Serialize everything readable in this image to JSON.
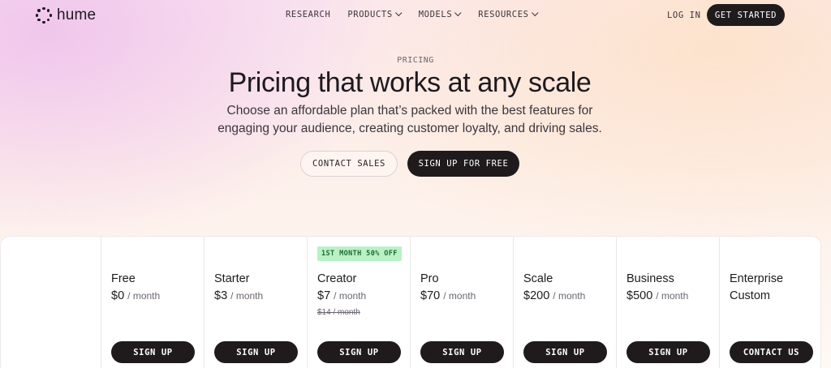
{
  "nav": {
    "logo_text": "hume",
    "links": [
      {
        "label": "RESEARCH",
        "has_dropdown": false
      },
      {
        "label": "PRODUCTS",
        "has_dropdown": true
      },
      {
        "label": "MODELS",
        "has_dropdown": true
      },
      {
        "label": "RESOURCES",
        "has_dropdown": true
      }
    ],
    "login_label": "LOG IN",
    "get_started_label": "GET STARTED"
  },
  "hero": {
    "eyebrow": "PRICING",
    "title": "Pricing that works at any scale",
    "subtitle_line1": "Choose an affordable plan that’s packed with the best features for",
    "subtitle_line2": "engaging your audience, creating customer loyalty, and driving sales.",
    "contact_sales_label": "CONTACT SALES",
    "signup_free_label": "SIGN UP FOR FREE"
  },
  "plans": [
    {
      "name": "Free",
      "price": "$0",
      "period": "/ month",
      "button": "SIGN UP"
    },
    {
      "name": "Starter",
      "price": "$3",
      "period": "/ month",
      "button": "SIGN UP"
    },
    {
      "name": "Creator",
      "price": "$7",
      "period": "/ month",
      "original_price": "$14 / month",
      "badge": "1ST MONTH 50% OFF",
      "button": "SIGN UP"
    },
    {
      "name": "Pro",
      "price": "$70",
      "period": "/ month",
      "button": "SIGN UP"
    },
    {
      "name": "Scale",
      "price": "$200",
      "period": "/ month",
      "button": "SIGN UP"
    },
    {
      "name": "Business",
      "price": "$500",
      "period": "/ month",
      "button": "SIGN UP"
    },
    {
      "name": "Enterprise",
      "price": "Custom",
      "period": "",
      "button": "CONTACT US"
    }
  ],
  "colors": {
    "dark_button": "#1f1b1d",
    "promo_badge_bg": "#b9f1c4",
    "promo_badge_text": "#1e6b35"
  }
}
